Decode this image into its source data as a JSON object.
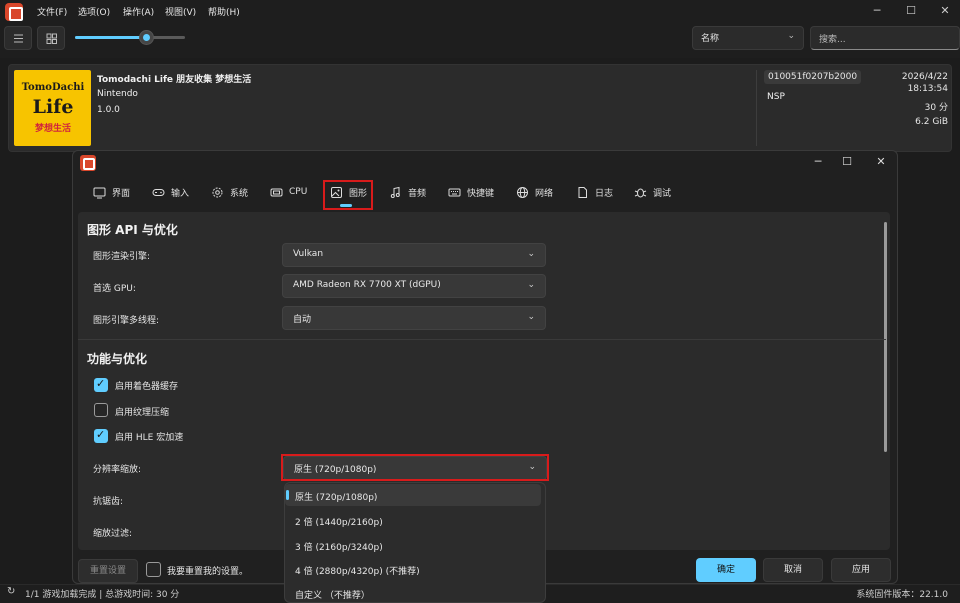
{
  "menu": [
    "文件(F)",
    "选项(O)",
    "操作(A)",
    "视图(V)",
    "帮助(H)"
  ],
  "toolbar": {
    "sort_value": "名称",
    "search_placeholder": "搜索..."
  },
  "game": {
    "cover_line1": "TomoDachi",
    "cover_line2": "Life",
    "cover_line3": "梦想生活",
    "title": "Tomodachi Life 朋友收集 梦想生活",
    "developer": "Nintendo",
    "version": "1.0.0",
    "title_id": "010051f0207b2000",
    "format": "NSP",
    "date": "2026/4/22",
    "time": "18:13:54",
    "playtime": "30 分",
    "size": "6.2 GiB"
  },
  "status": {
    "left": "1/1 游戏加载完成 | 总游戏时间: 30 分",
    "right": "系统固件版本：22.1.0"
  },
  "dialog": {
    "tabs": [
      {
        "label": "界面",
        "icon": "monitor-icon"
      },
      {
        "label": "输入",
        "icon": "gamepad-icon"
      },
      {
        "label": "系统",
        "icon": "gear-icon"
      },
      {
        "label": "CPU",
        "icon": "cpu-icon"
      },
      {
        "label": "图形",
        "icon": "image-icon"
      },
      {
        "label": "音频",
        "icon": "music-icon"
      },
      {
        "label": "快捷键",
        "icon": "keyboard-icon"
      },
      {
        "label": "网络",
        "icon": "globe-icon"
      },
      {
        "label": "日志",
        "icon": "file-icon"
      },
      {
        "label": "调试",
        "icon": "bug-icon"
      }
    ],
    "active_tab": "图形",
    "section1": "图形 API 与优化",
    "renderer_label": "图形渲染引擎:",
    "renderer_value": "Vulkan",
    "gpu_label": "首选 GPU:",
    "gpu_value": "AMD Radeon RX 7700 XT (dGPU)",
    "mt_label": "图形引擎多线程:",
    "mt_value": "自动",
    "section2": "功能与优化",
    "checks": [
      {
        "label": "启用着色器缓存",
        "checked": true
      },
      {
        "label": "启用纹理压缩",
        "checked": false
      },
      {
        "label": "启用 HLE 宏加速",
        "checked": true
      }
    ],
    "res_label": "分辨率缩放:",
    "res_value": "原生 (720p/1080p)",
    "aa_label": "抗锯齿:",
    "filter_label": "缩放过滤:",
    "res_options": [
      "原生 (720p/1080p)",
      "2 倍 (1440p/2160p)",
      "3 倍 (2160p/3240p)",
      "4 倍 (2880p/4320p) (不推荐)",
      "自定义 （不推荐）"
    ],
    "reset_btn": "重置设置",
    "reset_check": "我要重置我的设置。",
    "ok_btn": "确定",
    "cancel_btn": "取消",
    "apply_btn": "应用"
  },
  "colors": {
    "accent": "#60cdff",
    "highlight": "#d81b1b"
  }
}
